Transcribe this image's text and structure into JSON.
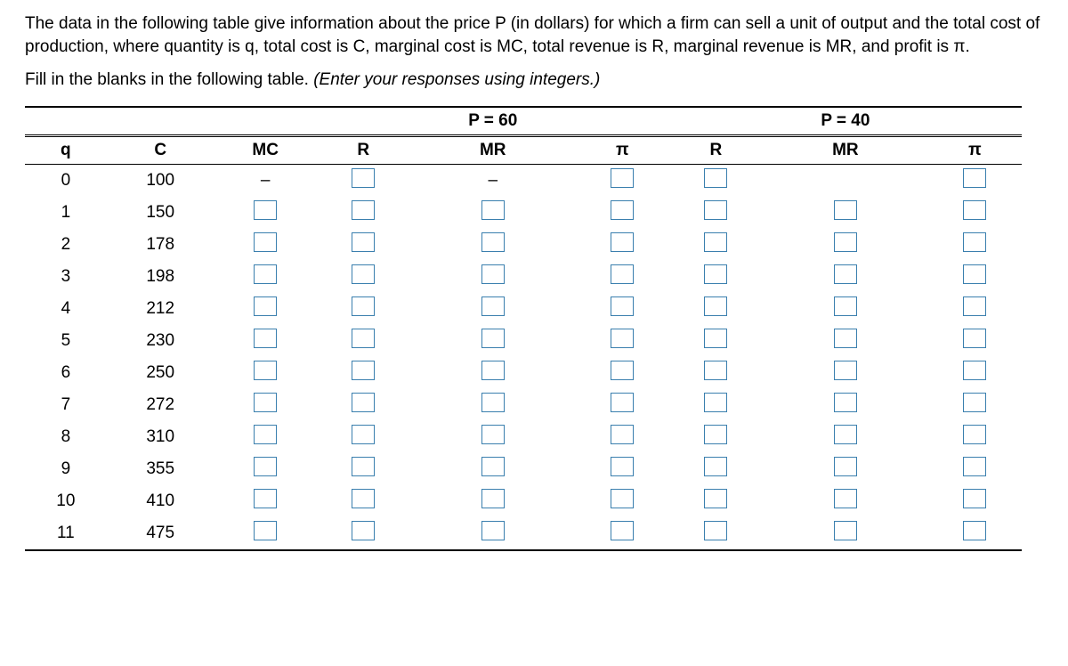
{
  "intro": "The data in the following table give information about the price P (in dollars) for which a firm can sell a unit of output and the total cost of production, where quantity is q, total cost is C, marginal cost is MC, total revenue is R, marginal revenue is MR, and profit is π.",
  "instruction_lead": "Fill in the blanks in the following table. ",
  "instruction_hint": "(Enter your responses using integers.)",
  "group_headers": {
    "p60": "P = 60",
    "p40": "P = 40"
  },
  "col_headers": {
    "q": "q",
    "C": "C",
    "MC": "MC",
    "R": "R",
    "MR": "MR",
    "pi": "π"
  },
  "dash": "–",
  "rows": [
    {
      "q": "0",
      "C": "100",
      "mc_dash": true,
      "mr60_dash": true,
      "mr40_blank": true
    },
    {
      "q": "1",
      "C": "150"
    },
    {
      "q": "2",
      "C": "178"
    },
    {
      "q": "3",
      "C": "198"
    },
    {
      "q": "4",
      "C": "212"
    },
    {
      "q": "5",
      "C": "230"
    },
    {
      "q": "6",
      "C": "250"
    },
    {
      "q": "7",
      "C": "272"
    },
    {
      "q": "8",
      "C": "310"
    },
    {
      "q": "9",
      "C": "355"
    },
    {
      "q": "10",
      "C": "410"
    },
    {
      "q": "11",
      "C": "475"
    }
  ],
  "chart_data": {
    "type": "table",
    "columns": [
      "q",
      "C",
      "MC",
      "R(P=60)",
      "MR(P=60)",
      "π(P=60)",
      "R(P=40)",
      "MR(P=40)",
      "π(P=40)"
    ],
    "q": [
      0,
      1,
      2,
      3,
      4,
      5,
      6,
      7,
      8,
      9,
      10,
      11
    ],
    "C": [
      100,
      150,
      178,
      198,
      212,
      230,
      250,
      272,
      310,
      355,
      410,
      475
    ],
    "prices": [
      60,
      40
    ],
    "blank_cells": "MC, R, MR, π for both price levels are inputs to be filled by user"
  }
}
